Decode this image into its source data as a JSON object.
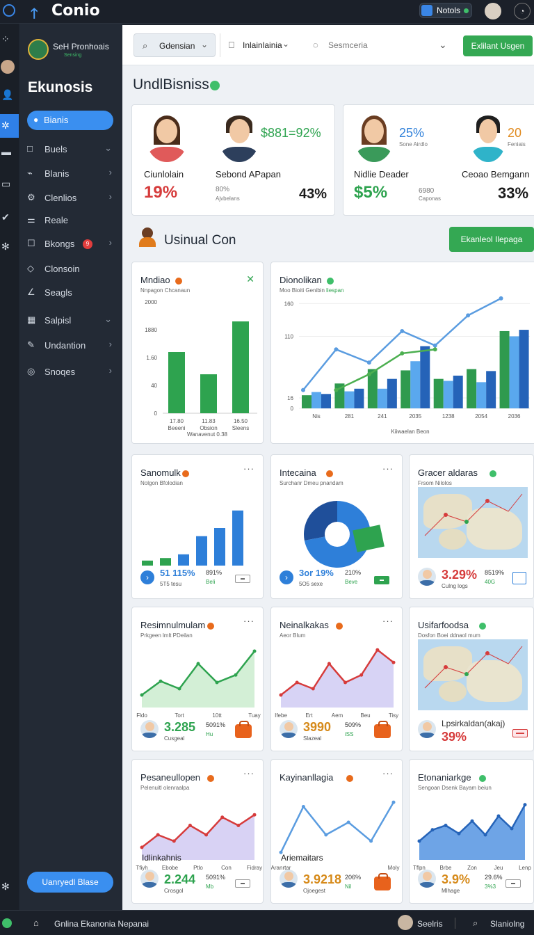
{
  "app": {
    "title": "Conio",
    "notif_label": "Notols"
  },
  "rail": {
    "icons": [
      "grid-icon",
      "user-icon",
      "settings-icon",
      "truck-icon",
      "folder-icon",
      "wrench-icon",
      "gear-icon",
      "bottom-gear-icon"
    ]
  },
  "sidebar": {
    "brand_name": "SeH Pronhoais",
    "brand_sub": "Sensing",
    "title": "Ekunosis",
    "active": "Bianis",
    "items": [
      {
        "label": "Buels",
        "icon": "□",
        "chevron": "⌄"
      },
      {
        "label": "Blanis",
        "icon": "⌁",
        "chevron": "›"
      },
      {
        "label": "Clenlios",
        "icon": "⚙",
        "chevron": "›"
      },
      {
        "label": "Reale",
        "icon": "⚌",
        "chevron": ""
      },
      {
        "label": "Bkongs",
        "icon": "☐",
        "chevron": "›",
        "badge": "9"
      },
      {
        "label": "Clonsoin",
        "icon": "◇",
        "chevron": ""
      },
      {
        "label": "Seagls",
        "icon": "∠",
        "chevron": ""
      },
      {
        "label": "Salpisl",
        "icon": "▦",
        "chevron": "⌄"
      },
      {
        "label": "Undantion",
        "icon": "✎",
        "chevron": "›"
      },
      {
        "label": "Snoqes",
        "icon": "◎",
        "chevron": "›"
      }
    ],
    "bottom_button": "Uanryedl Blase"
  },
  "toolbar": {
    "dropdown1": "Gdensian",
    "dropdown2": "Inlainlainia",
    "search_placeholder": "Sesmceria",
    "primary_button": "Exlilant Usgen"
  },
  "header": {
    "title": "UndlBisniss"
  },
  "stats": [
    {
      "name": "Ciunlolain",
      "value": "19%",
      "color": "red"
    },
    {
      "name": "Sebond APapan",
      "value": "43%",
      "extra_top": "$881=92%",
      "note": "80%",
      "note_sub": "Ajvbelans"
    },
    {
      "name": "Nidlie Deader",
      "value": "$5%",
      "extra_top": "25%",
      "extra_sub": "Sone Airdlo"
    },
    {
      "name": "Ceoao Bemgann",
      "value": "33%",
      "extra_top": "20",
      "extra_sub": "Feniais",
      "note": "6980",
      "note_sub": "Caponas"
    }
  ],
  "section": {
    "title": "Usinual Con",
    "button": "Ekanleol Ilepaga"
  },
  "chart_cards": [
    {
      "title": "Mndiao",
      "subtitle": "Nnpagon Chcanaun",
      "chart_data": {
        "type": "bar",
        "categories": [
          "17.80",
          "11.83",
          "16.50"
        ],
        "category_sub": [
          "Beeeni",
          "Obsion",
          "Sleens"
        ],
        "values": [
          1100,
          700,
          1650
        ],
        "ylim": [
          0,
          2000
        ],
        "yticks": [
          "0",
          "40",
          "1.60",
          "1880",
          "2000"
        ],
        "xfoot": "Wanavenut 0.38"
      }
    },
    {
      "title": "Dionolikan",
      "subtitle": "Moo Bioiti Genibin",
      "subtitle_accent": "liespan",
      "chart_data": {
        "type": "bar+line",
        "categories": [
          "Nis",
          "281",
          "241",
          "2035",
          "1238",
          "2054",
          "2036"
        ],
        "yticks": [
          "0",
          "16",
          "110",
          "160"
        ],
        "series": [
          {
            "name": "s1",
            "color": "#2f9a4e",
            "values": [
              20,
              38,
              60,
              58,
              45,
              60,
              118
            ]
          },
          {
            "name": "s2",
            "color": "#5aa8ee",
            "values": [
              25,
              26,
              30,
              72,
              42,
              40,
              110
            ]
          },
          {
            "name": "s3",
            "color": "#2563b8",
            "values": [
              22,
              30,
              45,
              95,
              50,
              57,
              120
            ]
          }
        ],
        "line": {
          "green": [
            28,
            52,
            84,
            90
          ],
          "blue": [
            28,
            90,
            70,
            118,
            96,
            142,
            168
          ]
        },
        "xlabel": "Kiiwaelan Beon"
      }
    }
  ],
  "tiles": [
    {
      "title": "Sanomulk",
      "sub": "Nolgon Bfolodian",
      "dot": "#e86b1c",
      "kind": "bars",
      "chart_data": {
        "type": "bar",
        "values": [
          8,
          12,
          18,
          47,
          60,
          88
        ]
      },
      "big": "51 115%",
      "big_sub": "5T5 tesu",
      "mid": "891%",
      "mid_sub": "Beli"
    },
    {
      "title": "Intecaina",
      "sub": "Surchanr Dmeu pnandam",
      "dot": "#e86b1c",
      "kind": "pie",
      "chart_data": {
        "type": "pie",
        "values": [
          72,
          28
        ]
      },
      "big": "3or 19%",
      "big_sub": "5O5 sexe",
      "mid": "210%",
      "mid_sub": "Beve"
    },
    {
      "title": "Gracer aldaras",
      "sub": "Frsom Nilolos",
      "dot": "#3fbf6a",
      "kind": "map",
      "big": "3.29%",
      "big_sub": "Culng logs",
      "mid": "8519%",
      "mid_sub": "40G"
    },
    {
      "title": "Resimnulmulam",
      "sub": "Prkgeen lmlt PDeilan",
      "dot": "#e86b1c",
      "kind": "area",
      "chart_data": {
        "type": "area",
        "values": [
          20,
          42,
          30,
          70,
          40,
          52,
          90
        ],
        "color": "#2ea34f",
        "fill": "#d3efd6"
      },
      "xt": [
        "Fldo",
        "Tort",
        "10tt",
        "Tuay"
      ],
      "big": "3.285",
      "big_sub": "Cusgeal",
      "mid": "5091%",
      "mid_sub": "Hu"
    },
    {
      "title": "Neinalkakas",
      "sub": "Aeor Blum",
      "dot": "#e86b1c",
      "kind": "area",
      "chart_data": {
        "type": "area",
        "values": [
          20,
          40,
          30,
          70,
          40,
          52,
          92,
          72
        ],
        "color": "#d63b3b",
        "fill": "#d7d3f5"
      },
      "xt": [
        "Ifebe",
        "Ert",
        "Aem",
        "Beu",
        "Tisy"
      ],
      "big": "3990",
      "big_sub": "Slazeal",
      "mid": "509%",
      "mid_sub": "iSS"
    },
    {
      "title": "Usifarfoodsa",
      "sub": "Dosfon Boei ddnaol mum",
      "dot": "#3fbf6a",
      "kind": "map",
      "big": "39%",
      "big_sub": "",
      "mid": "Lpsirkaldan(akaj)",
      "mid_sub": ""
    },
    {
      "title": "Pesaneullopen",
      "sub": "Pelenuitl olenraalpa",
      "dot": "#e86b1c",
      "kind": "area",
      "chart_data": {
        "type": "area",
        "values": [
          20,
          40,
          30,
          55,
          40,
          68,
          55,
          72
        ],
        "color": "#d63b3b",
        "fill": "#d8d2f4"
      },
      "xt": [
        "Tfiyh",
        "Ebobe",
        "Ptlo",
        "Con",
        "Fidray"
      ],
      "legend": "Idlinkahnis",
      "big": "2.244",
      "big_sub": "Crosgol",
      "mid": "5091%",
      "mid_sub": "Mb"
    },
    {
      "title": "Kayinanllagia",
      "sub": "",
      "dot": "#e86b1c",
      "kind": "line",
      "chart_data": {
        "type": "line",
        "values": [
          12,
          85,
          40,
          60,
          30,
          92
        ],
        "color": "#5a9ce0"
      },
      "xt": [
        "Aranrtar",
        "Moly"
      ],
      "legend": "Ariemaitars",
      "big": "3.9218",
      "big_sub": "Ojoegest",
      "mid": "206%",
      "mid_sub": "Nil"
    },
    {
      "title": "Etonaniarkge",
      "sub": "Sengoan Dsenk Bayam beiun",
      "dot": "#3fbf6a",
      "kind": "area",
      "chart_data": {
        "type": "area",
        "values": [
          30,
          48,
          55,
          42,
          62,
          40,
          70,
          50,
          88
        ],
        "color": "#2563b8",
        "fill": "#6ea4e6"
      },
      "xt": [
        "Tflpn",
        "Brbe",
        "Zon",
        "Jeu",
        "Lenp"
      ],
      "big": "3.9%",
      "big_sub": "Mlhage",
      "mid": "29.6%",
      "mid_sub": "3%3"
    }
  ],
  "status": {
    "text": "Gnlina Ekanonia Nepanai",
    "user": "Seelris",
    "right": "Slaniolng"
  }
}
